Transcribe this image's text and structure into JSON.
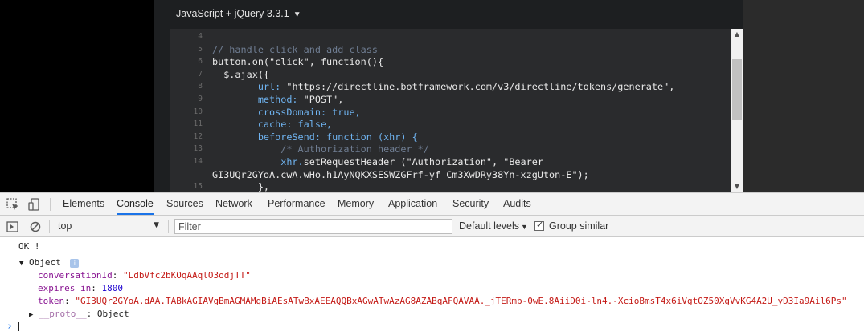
{
  "editor": {
    "language": "JavaScript + jQuery 3.3.1",
    "lines": [
      {
        "n": "4",
        "code": [
          {
            "t": "",
            "c": "plain"
          }
        ]
      },
      {
        "n": "5",
        "code": [
          {
            "t": "// handle click and add class",
            "c": "cm"
          }
        ]
      },
      {
        "n": "6",
        "code": [
          {
            "t": "button.on(\"click\", function(){",
            "c": "plain"
          }
        ]
      },
      {
        "n": "7",
        "code": [
          {
            "t": "  $.ajax({",
            "c": "plain"
          }
        ]
      },
      {
        "n": "8",
        "code": [
          {
            "t": "        url: ",
            "c": "kw"
          },
          {
            "t": "\"https://directline.botframework.com/v3/directline/tokens/generate\",",
            "c": "str"
          }
        ]
      },
      {
        "n": "9",
        "code": [
          {
            "t": "        method: ",
            "c": "kw"
          },
          {
            "t": "\"POST\",",
            "c": "str"
          }
        ]
      },
      {
        "n": "10",
        "code": [
          {
            "t": "        crossDomain: true,",
            "c": "kw"
          }
        ]
      },
      {
        "n": "11",
        "code": [
          {
            "t": "        cache: false,",
            "c": "kw"
          }
        ]
      },
      {
        "n": "12",
        "code": [
          {
            "t": "        beforeSend: function (xhr) {",
            "c": "kw"
          }
        ]
      },
      {
        "n": "13",
        "code": [
          {
            "t": "            /* Authorization header */",
            "c": "cm"
          }
        ]
      },
      {
        "n": "14",
        "code": [
          {
            "t": "            xhr.",
            "c": "kw"
          },
          {
            "t": "setRequestHeader (\"Authorization\", \"Bearer",
            "c": "plain"
          }
        ]
      },
      {
        "n": "",
        "code": [
          {
            "t": "GI3UQr2GYoA.cwA.wHo.h1AyNQKXSESWZGFrf-yf_Cm3XwDRy38Yn-xzgUton-E\");",
            "c": "plain"
          }
        ]
      },
      {
        "n": "15",
        "code": [
          {
            "t": "        },",
            "c": "plain"
          }
        ]
      }
    ]
  },
  "devtools": {
    "tabs": [
      "Elements",
      "Console",
      "Sources",
      "Network",
      "Performance",
      "Memory",
      "Application",
      "Security",
      "Audits"
    ],
    "active_tab": "Console",
    "toolbar": {
      "context": "top",
      "filter_placeholder": "Filter",
      "levels": "Default levels",
      "group_similar": "Group similar"
    },
    "console": {
      "ok_line": "OK !",
      "object_label": "Object",
      "entries": [
        {
          "key": "conversationId",
          "value": "\"LdbVfc2bKOqAAqlO3odjTT\""
        },
        {
          "key": "expires_in",
          "value": "1800"
        },
        {
          "key": "token",
          "value": "\"GI3UQr2GYoA.dAA.TABkAGIAVgBmAGMAMgBiAEsATwBxAEEAQQBxAGwATwAzAG8AZABqAFQAVAA._jTERmb-0wE.8AiiD0i-ln4.-XcioBmsT4x6iVgtOZ50XgVvKG4A2U_yD3Ia9Ail6Ps\""
        }
      ],
      "proto_key": "__proto__",
      "proto_value": "Object",
      "prompt": "›"
    }
  },
  "colors": {
    "accent": "#1a73e8",
    "key": "#881391",
    "string": "#c41a16",
    "number": "#1c00cf"
  }
}
